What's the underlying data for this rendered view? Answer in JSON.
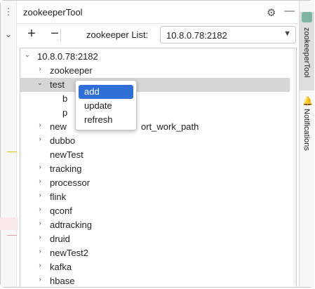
{
  "panel": {
    "title": "zookeeperTool"
  },
  "toolbar": {
    "add_glyph": "+",
    "remove_glyph": "−",
    "list_label": "zookeeper List:",
    "server_value": "10.8.0.78:2182"
  },
  "tree": {
    "root": "10.8.0.78:2182",
    "children": [
      {
        "label": "zookeeper",
        "chevron": "›",
        "hidden_part": ""
      },
      {
        "label": "test",
        "chevron": "⌄"
      },
      {
        "label": "b"
      },
      {
        "label": "p"
      },
      {
        "label": "new",
        "label_tail": "ort_work_path",
        "chevron": "›"
      },
      {
        "label": "dubbo",
        "chevron": "›"
      },
      {
        "label": "newTest"
      },
      {
        "label": "tracking",
        "chevron": "›"
      },
      {
        "label": "processor",
        "chevron": "›"
      },
      {
        "label": "flink",
        "chevron": "›"
      },
      {
        "label": "qconf",
        "chevron": "›"
      },
      {
        "label": "adtracking",
        "chevron": "›"
      },
      {
        "label": "druid",
        "chevron": "›"
      },
      {
        "label": "newTest2",
        "chevron": "›"
      },
      {
        "label": "kafka",
        "chevron": "›"
      },
      {
        "label": "hbase",
        "chevron": "›"
      }
    ]
  },
  "context_menu": {
    "items": [
      {
        "label": "add",
        "active": true
      },
      {
        "label": "update",
        "active": false
      },
      {
        "label": "refresh",
        "active": false
      }
    ]
  },
  "right_strip": {
    "tab_zk": "zookeeperTool",
    "tab_notifications": "Notifications"
  },
  "colors": {
    "selection": "#2f6fd6",
    "row_selected": "#d6d6d6"
  },
  "icons": {
    "gear": "gear-icon",
    "minimize": "minimize-icon",
    "dots": "more-vertical-icon",
    "chevron_down": "chevron-down-icon",
    "bell": "bell-icon"
  }
}
